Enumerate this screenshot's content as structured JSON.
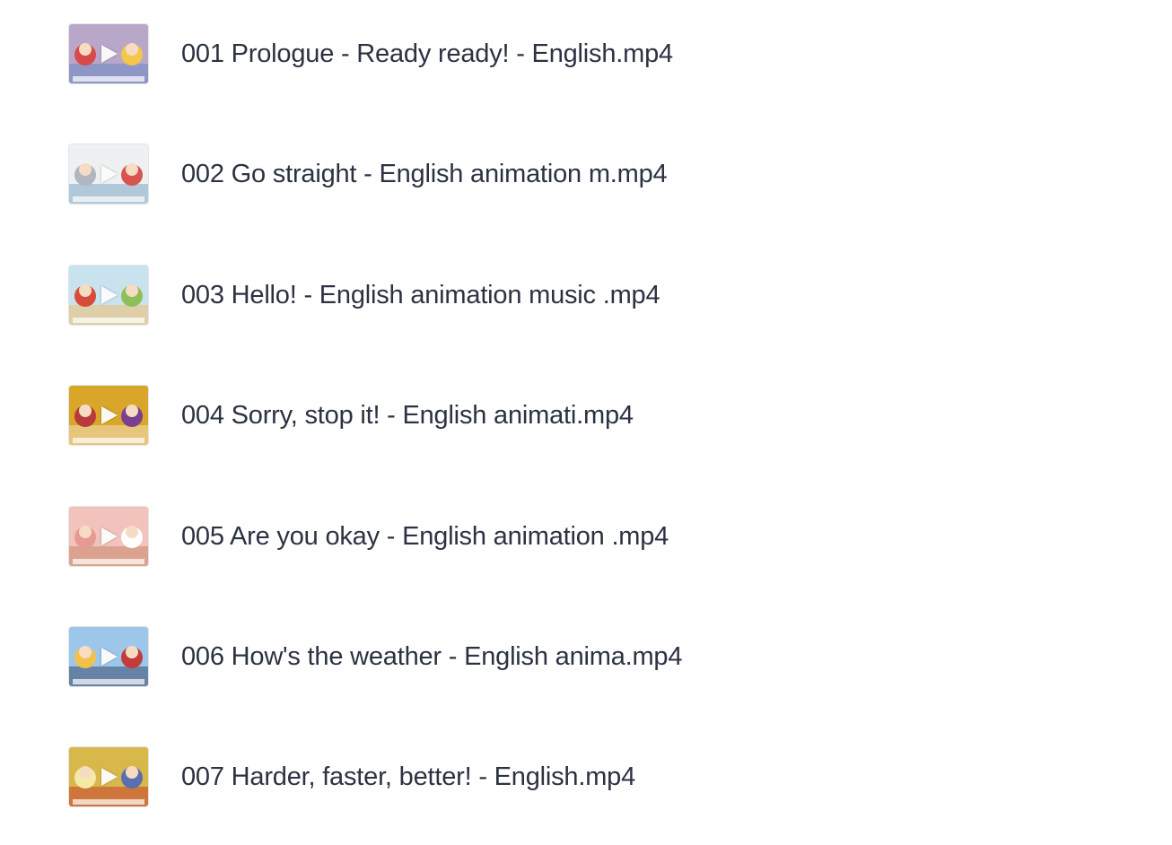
{
  "files": [
    {
      "name": "001 Prologue - Ready ready! - English.mp4",
      "thumb_colors": [
        "#b9a7c9",
        "#d84a4a",
        "#f3c74a",
        "#6c88c2"
      ]
    },
    {
      "name": "002 Go straight - English animation m.mp4",
      "thumb_colors": [
        "#eef0f2",
        "#b0b6bd",
        "#d9534f",
        "#7fa7c9"
      ]
    },
    {
      "name": "003 Hello! - English animation music .mp4",
      "thumb_colors": [
        "#c9e3ee",
        "#d64b3a",
        "#8fbf5a",
        "#f0c070"
      ]
    },
    {
      "name": "004 Sorry, stop it! - English animati.mp4",
      "thumb_colors": [
        "#d9a62a",
        "#b83a3a",
        "#7a3f8f",
        "#f3e0c0"
      ]
    },
    {
      "name": "005 Are you okay - English animation .mp4",
      "thumb_colors": [
        "#f2c2bd",
        "#e79a94",
        "#ffffff",
        "#c98a6a"
      ]
    },
    {
      "name": "006 How's the weather - English anima.mp4",
      "thumb_colors": [
        "#9cc7ea",
        "#f2c14a",
        "#c33c3c",
        "#3b4a6b"
      ]
    },
    {
      "name": "007 Harder, faster, better! - English.mp4",
      "thumb_colors": [
        "#d8b84a",
        "#f5e9a8",
        "#5a6fb0",
        "#c7402f"
      ]
    }
  ]
}
